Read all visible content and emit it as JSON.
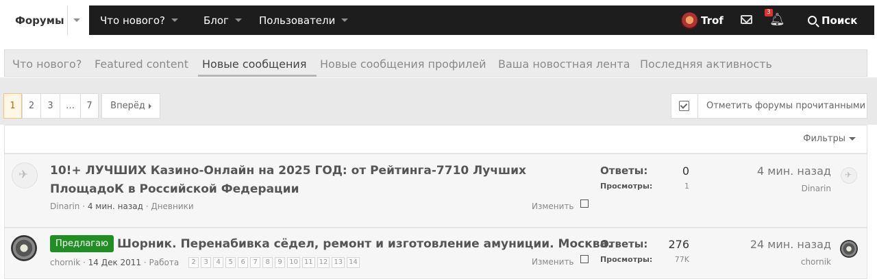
{
  "topnav": {
    "active_tab": "Форумы",
    "items": [
      {
        "label": "Что нового?"
      },
      {
        "label": "Блог"
      },
      {
        "label": "Пользователи"
      }
    ],
    "user": {
      "name": "Trof"
    },
    "alerts_count": "3",
    "search_label": "Поиск"
  },
  "subnav": {
    "items": [
      {
        "label": "Что нового?"
      },
      {
        "label": "Featured content"
      },
      {
        "label": "Новые сообщения"
      },
      {
        "label": "Новые сообщения профилей"
      },
      {
        "label": "Ваша новостная лента"
      },
      {
        "label": "Последняя активность"
      }
    ],
    "active_index": 2
  },
  "pagination": {
    "pages": [
      "1",
      "2",
      "3",
      "…",
      "7"
    ],
    "current": "1",
    "next_label": "Вперёд"
  },
  "mark_read_label": "Отметить форумы прочитанными",
  "filters_label": "Фильтры",
  "labels": {
    "replies": "Ответы:",
    "views": "Просмотры:",
    "edit": "Изменить"
  },
  "threads": [
    {
      "title": "10!+ ЛУЧШИХ Казино-Онлайн на 2025 ГОД: от Рейтинга-7710 Лучших ПлощадоК в Российской Федерации",
      "prefix": "",
      "author": "Dinarin",
      "date": "4 мин. назад",
      "forum": "Дневники",
      "replies": "0",
      "views": "1",
      "last_time": "4 мин. назад",
      "last_user": "Dinarin",
      "pages": []
    },
    {
      "title": "Шорник. Перенабивка сёдел, ремонт и изготовление амуниции. Москва.",
      "prefix": "Предлагаю",
      "author": "chornik",
      "date": "14 Дек 2011",
      "forum": "Работа",
      "replies": "276",
      "views": "77K",
      "last_time": "24 мин. назад",
      "last_user": "chornik",
      "pages": [
        "2",
        "3",
        "4",
        "5",
        "6",
        "7",
        "8",
        "9",
        "10",
        "11",
        "12",
        "13",
        "14"
      ]
    }
  ]
}
